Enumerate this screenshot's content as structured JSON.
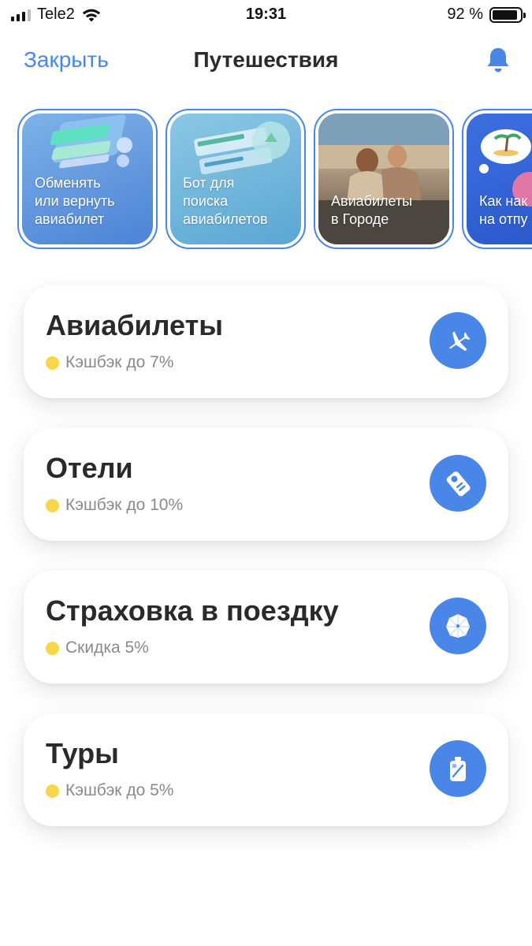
{
  "status_bar": {
    "carrier": "Tele2",
    "time": "19:31",
    "battery": "92 %",
    "battery_level": 0.92
  },
  "nav": {
    "close_label": "Закрыть",
    "title": "Путешествия",
    "bell_icon": "bell-icon"
  },
  "colors": {
    "accent": "#4a86e8",
    "cashback_dot": "#f7d64a"
  },
  "stories": [
    {
      "label": "Обменять\nили вернуть\nавиабилет",
      "art": "phone-tickets"
    },
    {
      "label": "Бот для\nпоиска\nавиабилетов",
      "art": "tickets-bell"
    },
    {
      "label": "Авиабилеты\nв Городе",
      "art": "photo-couple"
    },
    {
      "label": "Как нак\nна отпу",
      "art": "island-thought"
    }
  ],
  "services": [
    {
      "title": "Авиабилеты",
      "subtitle": "Кэшбэк до 7%",
      "icon": "airplane-icon"
    },
    {
      "title": "Отели",
      "subtitle": "Кэшбэк до 10%",
      "icon": "door-hanger-icon"
    },
    {
      "title": "Страховка в поездку",
      "subtitle": "Скидка 5%",
      "icon": "umbrella-icon"
    },
    {
      "title": "Туры",
      "subtitle": "Кэшбэк до 5%",
      "icon": "suitcase-icon"
    }
  ]
}
